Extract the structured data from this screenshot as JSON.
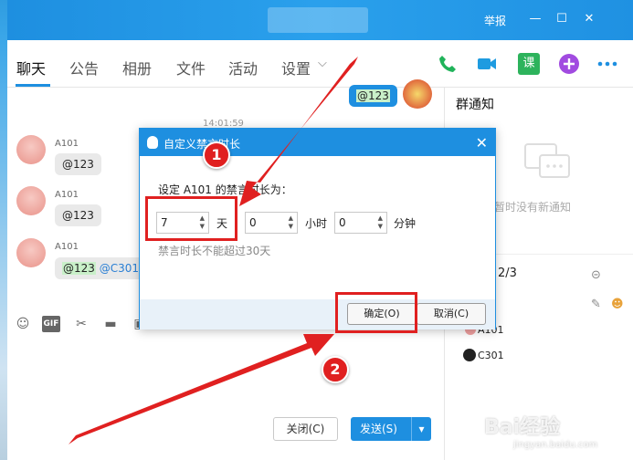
{
  "titlebar": {
    "report": "举报",
    "minimize": "—",
    "maximize": "☐",
    "close": "✕"
  },
  "tabs": [
    {
      "label": "聊天"
    },
    {
      "label": "公告"
    },
    {
      "label": "相册"
    },
    {
      "label": "文件"
    },
    {
      "label": "活动"
    },
    {
      "label": "设置"
    }
  ],
  "top_icons": {
    "course": "课"
  },
  "chat": {
    "mine": {
      "text": "@123"
    },
    "timestamp": "14:01:59",
    "messages": [
      {
        "sender": "A101",
        "text": "@123"
      },
      {
        "sender": "A101",
        "text": "@123"
      },
      {
        "sender": "A101",
        "text": "@123",
        "mention": "@C301"
      }
    ]
  },
  "footer": {
    "close": "关闭(C)",
    "send": "发送(S)",
    "send_caret": "▾"
  },
  "sidebar": {
    "title": "群通知",
    "empty": "暂时没有新通知",
    "count": "2/3",
    "members": [
      "A101",
      "C301"
    ]
  },
  "dialog": {
    "title": "自定义禁言时长",
    "prompt": "设定 A101 的禁言时长为：",
    "days": "7",
    "days_unit": "天",
    "hours": "0",
    "hours_unit": "小时",
    "minutes": "0",
    "minutes_unit": "分钟",
    "hint": "禁言时长不能超过30天",
    "ok": "确定(O)",
    "cancel": "取消(C)",
    "close": "✕"
  },
  "annotations": {
    "step1": "1",
    "step2": "2",
    "color": "#e02020"
  },
  "watermark": {
    "main": "Bai经验",
    "sub": "jingyan.baidu.com"
  }
}
